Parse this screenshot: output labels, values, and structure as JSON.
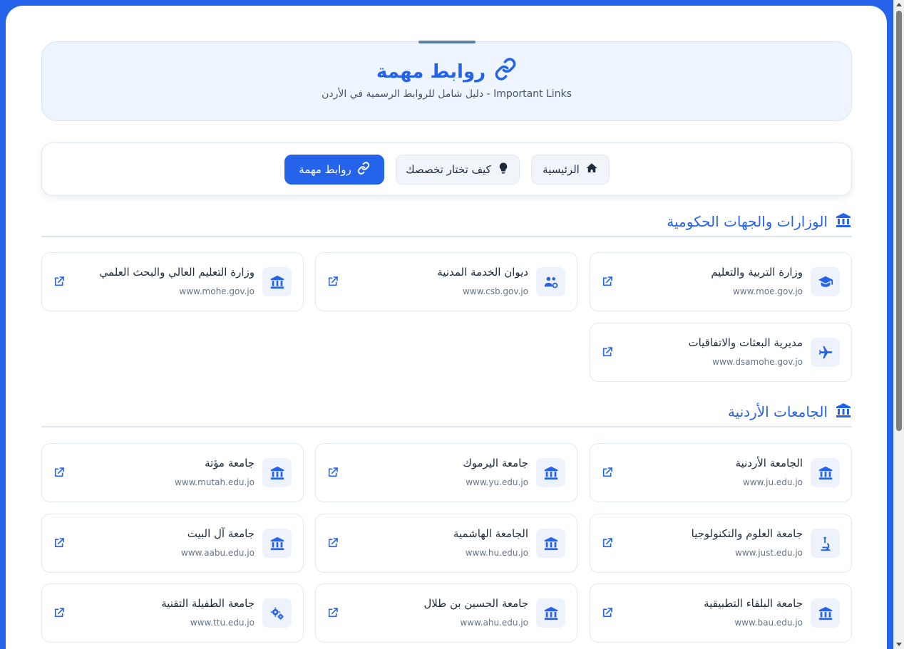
{
  "header": {
    "title": "روابط مهمة",
    "subtitle": "Important Links - دليل شامل للروابط الرسمية في الأردن",
    "icon": "link-icon"
  },
  "nav": {
    "home_label": "الرئيسية",
    "choose_label": "كيف تختار تخصصك",
    "links_label": "روابط مهمة",
    "active": "links"
  },
  "sections": [
    {
      "title": "الوزارات والجهات الحكومية",
      "icon": "institution-icon",
      "items": [
        {
          "title": "وزارة التربية والتعليم",
          "url": "www.moe.gov.jo",
          "icon": "graduation-cap-icon"
        },
        {
          "title": "ديوان الخدمة المدنية",
          "url": "www.csb.gov.jo",
          "icon": "users-cog-icon"
        },
        {
          "title": "وزارة التعليم العالي والبحث العلمي",
          "url": "www.mohe.gov.jo",
          "icon": "institution-icon"
        },
        {
          "title": "مديرية البعثات والاتفاقيات",
          "url": "www.dsamohe.gov.jo",
          "icon": "plane-icon"
        }
      ]
    },
    {
      "title": "الجامعات الأردنية",
      "icon": "institution-icon",
      "items": [
        {
          "title": "الجامعة الأردنية",
          "url": "www.ju.edu.jo",
          "icon": "institution-icon"
        },
        {
          "title": "جامعة اليرموك",
          "url": "www.yu.edu.jo",
          "icon": "institution-icon"
        },
        {
          "title": "جامعة مؤتة",
          "url": "www.mutah.edu.jo",
          "icon": "institution-icon"
        },
        {
          "title": "جامعة العلوم والتكنولوجيا",
          "url": "www.just.edu.jo",
          "icon": "microscope-icon"
        },
        {
          "title": "الجامعة الهاشمية",
          "url": "www.hu.edu.jo",
          "icon": "institution-icon"
        },
        {
          "title": "جامعة آل البيت",
          "url": "www.aabu.edu.jo",
          "icon": "institution-icon"
        },
        {
          "title": "جامعة البلقاء التطبيقية",
          "url": "www.bau.edu.jo",
          "icon": "institution-icon"
        },
        {
          "title": "جامعة الحسين بن طلال",
          "url": "www.ahu.edu.jo",
          "icon": "institution-icon"
        },
        {
          "title": "جامعة الطفيلة التقنية",
          "url": "www.ttu.edu.jo",
          "icon": "cogs-icon"
        }
      ]
    }
  ],
  "colors": {
    "accent": "#2563eb",
    "background": "#2563eb",
    "header_bg": "#eff5ff"
  }
}
